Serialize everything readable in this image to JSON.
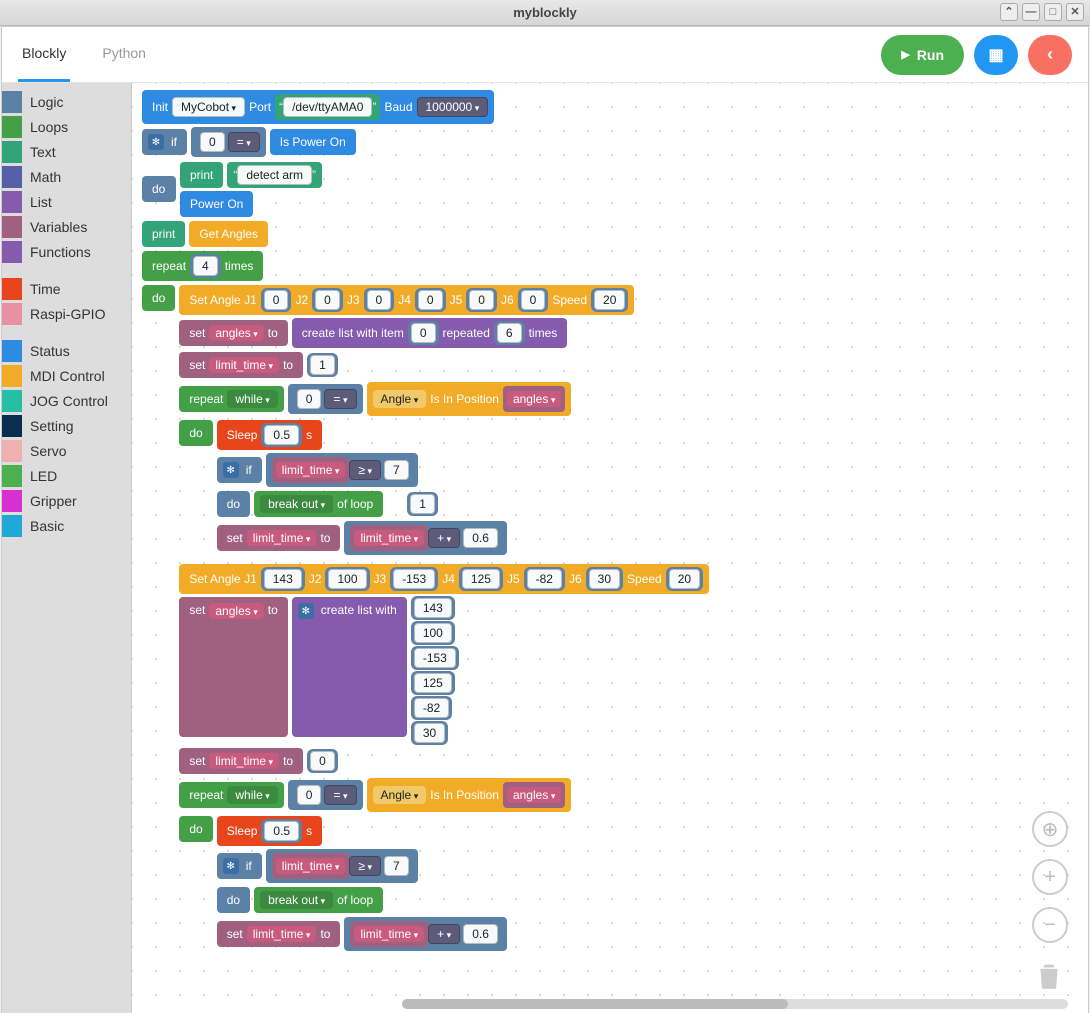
{
  "window": {
    "title": "myblockly"
  },
  "tabs": {
    "blockly": "Blockly",
    "python": "Python"
  },
  "buttons": {
    "run": "Run"
  },
  "toolbox": {
    "core": [
      {
        "label": "Logic",
        "color": "#5c81a6"
      },
      {
        "label": "Loops",
        "color": "#44a047"
      },
      {
        "label": "Text",
        "color": "#33a37a"
      },
      {
        "label": "Math",
        "color": "#5560a6"
      },
      {
        "label": "List",
        "color": "#855cad"
      },
      {
        "label": "Variables",
        "color": "#a0607f"
      },
      {
        "label": "Functions",
        "color": "#855cad"
      }
    ],
    "ext1": [
      {
        "label": "Time",
        "color": "#e8451d"
      },
      {
        "label": "Raspi-GPIO",
        "color": "#e891a3"
      }
    ],
    "ext2": [
      {
        "label": "Status",
        "color": "#2f8ae2"
      },
      {
        "label": "MDI Control",
        "color": "#f2ab26"
      },
      {
        "label": "JOG Control",
        "color": "#26bfa6"
      },
      {
        "label": "Setting",
        "color": "#0b2e4f"
      },
      {
        "label": "Servo",
        "color": "#f0b0b0"
      },
      {
        "label": "LED",
        "color": "#4caf50"
      },
      {
        "label": "Gripper",
        "color": "#d82fd1"
      },
      {
        "label": "Basic",
        "color": "#1fa8d8"
      }
    ]
  },
  "blocks": {
    "init": {
      "label": "Init",
      "device": "MyCobot",
      "port_label": "Port",
      "port": "/dev/ttyAMA0",
      "baud_label": "Baud",
      "baud": "1000000"
    },
    "if": "if",
    "do": "do",
    "eq": "=",
    "power_check": "Is Power On",
    "print": "print",
    "detect": "detect arm",
    "power_on": "Power On",
    "get_angles": "Get Angles",
    "repeat": "repeat",
    "times": "times",
    "repeat_n": "4",
    "set_angle": {
      "label": "Set Angle J1",
      "j": [
        "J2",
        "J3",
        "J4",
        "J5",
        "J6"
      ],
      "speed": "Speed"
    },
    "sa1": {
      "j1": "0",
      "j2": "0",
      "j3": "0",
      "j4": "0",
      "j5": "0",
      "j6": "0",
      "sp": "20"
    },
    "set": "set",
    "to": "to",
    "angles_var": "angles",
    "limit_var": "limit_time",
    "create_list_repeat": {
      "a": "create list with item",
      "b": "repeated",
      "c": "times",
      "item": "0",
      "n": "6"
    },
    "limit_init": "1",
    "while": "while",
    "isinpos": {
      "a": "Angle",
      "b": "Is In Position"
    },
    "sleep": {
      "a": "Sleep",
      "b": "s",
      "v": "0.5"
    },
    "ge": "≥",
    "seven": "7",
    "breakout": {
      "a": "break out",
      "b": "of loop"
    },
    "one": "1",
    "plus": "+",
    "inc": "0.6",
    "sa2": {
      "j1": "143",
      "j2": "100",
      "j3": "-153",
      "j4": "125",
      "j5": "-82",
      "j6": "30",
      "sp": "20"
    },
    "create_list_with": "create list with",
    "list2": [
      "143",
      "100",
      "-153",
      "125",
      "-82",
      "30"
    ],
    "limit_init2": "0"
  }
}
